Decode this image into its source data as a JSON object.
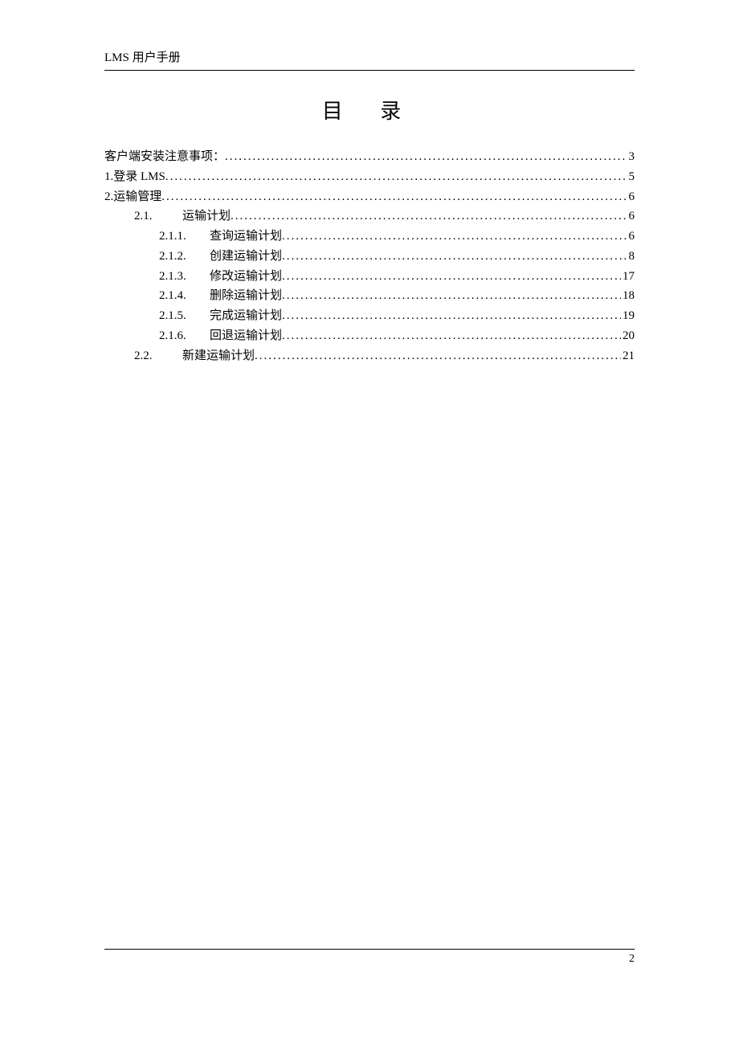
{
  "header": "LMS 用户手册",
  "title": "目 录",
  "page_number": "2",
  "toc": [
    {
      "number": "",
      "text": "客户端安装注意事项：",
      "page": "3",
      "indent": 0,
      "style": "first"
    },
    {
      "number": "1.",
      "text": "登录 LMS",
      "page": "5",
      "indent": 0,
      "style": "main"
    },
    {
      "number": "2.",
      "text": "运输管理",
      "page": "6",
      "indent": 0,
      "style": "main"
    },
    {
      "number": "2.1.",
      "text": "运输计划",
      "page": "6",
      "indent": 1,
      "style": "main"
    },
    {
      "number": "2.1.1.",
      "text": "查询运输计划",
      "page": "6",
      "indent": 2,
      "style": "sub"
    },
    {
      "number": "2.1.2.",
      "text": "创建运输计划",
      "page": "8",
      "indent": 2,
      "style": "sub"
    },
    {
      "number": "2.1.3.",
      "text": "修改运输计划",
      "page": "17",
      "indent": 2,
      "style": "sub"
    },
    {
      "number": "2.1.4.",
      "text": "删除运输计划",
      "page": "18",
      "indent": 2,
      "style": "sub"
    },
    {
      "number": "2.1.5.",
      "text": "完成运输计划",
      "page": "19",
      "indent": 2,
      "style": "sub"
    },
    {
      "number": "2.1.6.",
      "text": "回退运输计划",
      "page": "20",
      "indent": 2,
      "style": "sub"
    },
    {
      "number": "2.2.",
      "text": "新建运输计划",
      "page": "21",
      "indent": 1,
      "style": "main"
    }
  ]
}
